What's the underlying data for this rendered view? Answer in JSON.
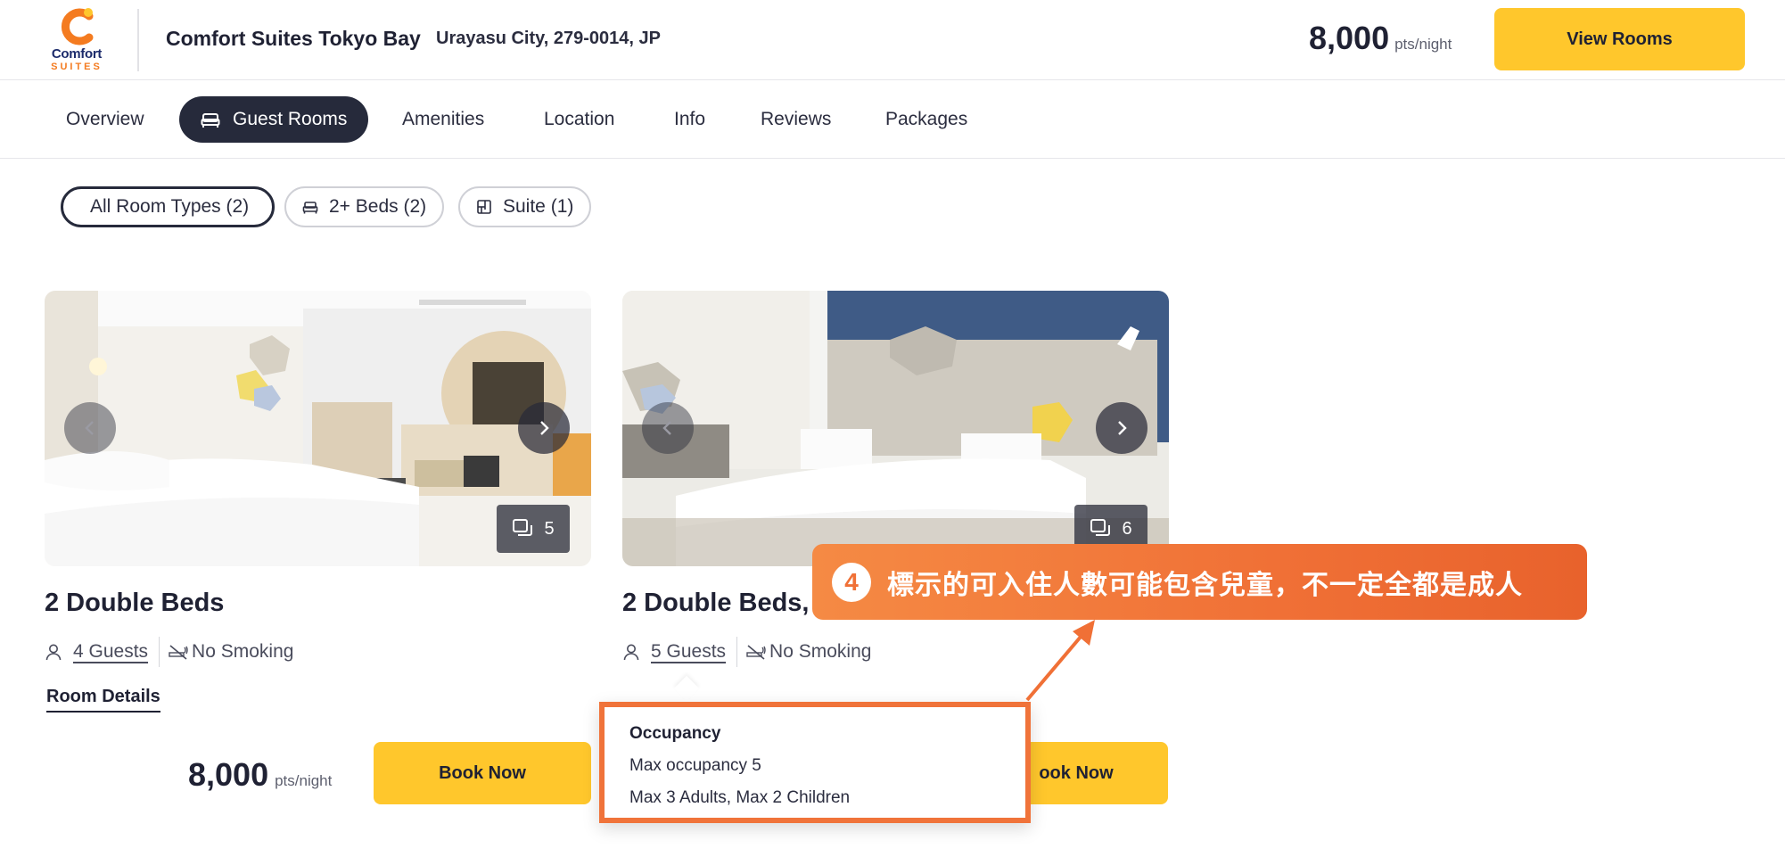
{
  "header": {
    "logo": {
      "word": "Comfort",
      "sub": "SUITES"
    },
    "hotel_name": "Comfort Suites Tokyo Bay",
    "address": "Urayasu City, 279-0014, JP",
    "price": "8,000",
    "price_unit": "pts/night",
    "view_rooms_label": "View Rooms"
  },
  "tabs": [
    {
      "label": "Overview",
      "active": false
    },
    {
      "label": "Guest Rooms",
      "active": true,
      "icon": "bed-icon"
    },
    {
      "label": "Amenities",
      "active": false
    },
    {
      "label": "Location",
      "active": false
    },
    {
      "label": "Info",
      "active": false
    },
    {
      "label": "Reviews",
      "active": false
    },
    {
      "label": "Packages",
      "active": false
    }
  ],
  "filters": [
    {
      "label": "All Room Types (2)",
      "active": true
    },
    {
      "label": "2+ Beds (2)",
      "active": false,
      "icon": "bed-icon"
    },
    {
      "label": "Suite (1)",
      "active": false,
      "icon": "suite-icon"
    }
  ],
  "rooms": [
    {
      "title": "2 Double Beds",
      "guests": "4 Guests",
      "smoking": "No Smoking",
      "photo_count": "5",
      "details_label": "Room Details",
      "price": "8,000",
      "price_unit": "pts/night",
      "book_label": "Book Now"
    },
    {
      "title": "2 Double Beds,",
      "guests": "5 Guests",
      "smoking": "No Smoking",
      "photo_count": "6",
      "book_label": "ook Now"
    }
  ],
  "tooltip": {
    "title": "Occupancy",
    "line1": "Max occupancy 5",
    "line2": "Max 3 Adults, Max 2 Children"
  },
  "annotation": {
    "number": "4",
    "text": "標示的可入住人數可能包含兒童，不一定全都是成人"
  },
  "colors": {
    "accent_yellow": "#ffc72c",
    "nav_dark": "#262a3b",
    "annotation_orange": "#f07036",
    "brand_orange": "#f47b20",
    "brand_navy": "#1c2b6b"
  }
}
